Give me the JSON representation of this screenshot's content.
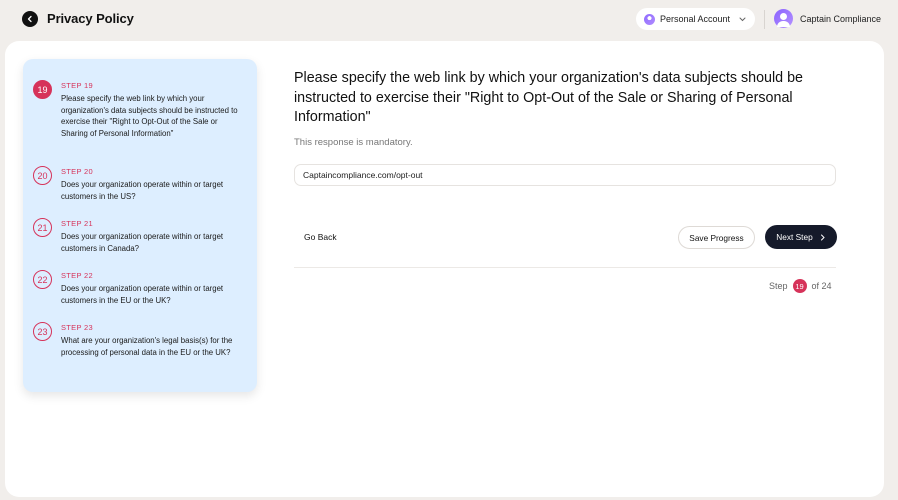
{
  "header": {
    "title": "Privacy Policy",
    "account_label": "Personal Account",
    "user_name": "Captain Compliance"
  },
  "steps": [
    {
      "number": "19",
      "label": "STEP 19",
      "text": "Please specify the web link by which your organization's data subjects should be instructed to exercise their \"Right to Opt-Out of the Sale or Sharing of Personal Information\"",
      "active": true
    },
    {
      "number": "20",
      "label": "STEP 20",
      "text": "Does your organization operate within or target customers in the US?",
      "active": false
    },
    {
      "number": "21",
      "label": "STEP 21",
      "text": "Does your organization operate within or target customers in Canada?",
      "active": false
    },
    {
      "number": "22",
      "label": "STEP 22",
      "text": "Does your organization operate within or target customers in the EU or the UK?",
      "active": false
    },
    {
      "number": "23",
      "label": "STEP 23",
      "text": "What are your organization's legal basis(s) for the processing of personal data in the EU or the UK?",
      "active": false
    }
  ],
  "form": {
    "question": "Please specify the web link by which your organization's data subjects should be instructed to exercise their \"Right to Opt-Out of the Sale or Sharing of Personal Information\"",
    "mandatory_note": "This response is mandatory.",
    "input_value": "Captaincompliance.com/opt-out",
    "go_back_label": "Go Back",
    "save_label": "Save Progress",
    "next_label": "Next Step"
  },
  "progress": {
    "prefix": "Step",
    "current": "19",
    "suffix": "of 24"
  },
  "colors": {
    "accent": "#d6335a",
    "panel": "#ddeeff",
    "primary_button": "#151a2a"
  }
}
